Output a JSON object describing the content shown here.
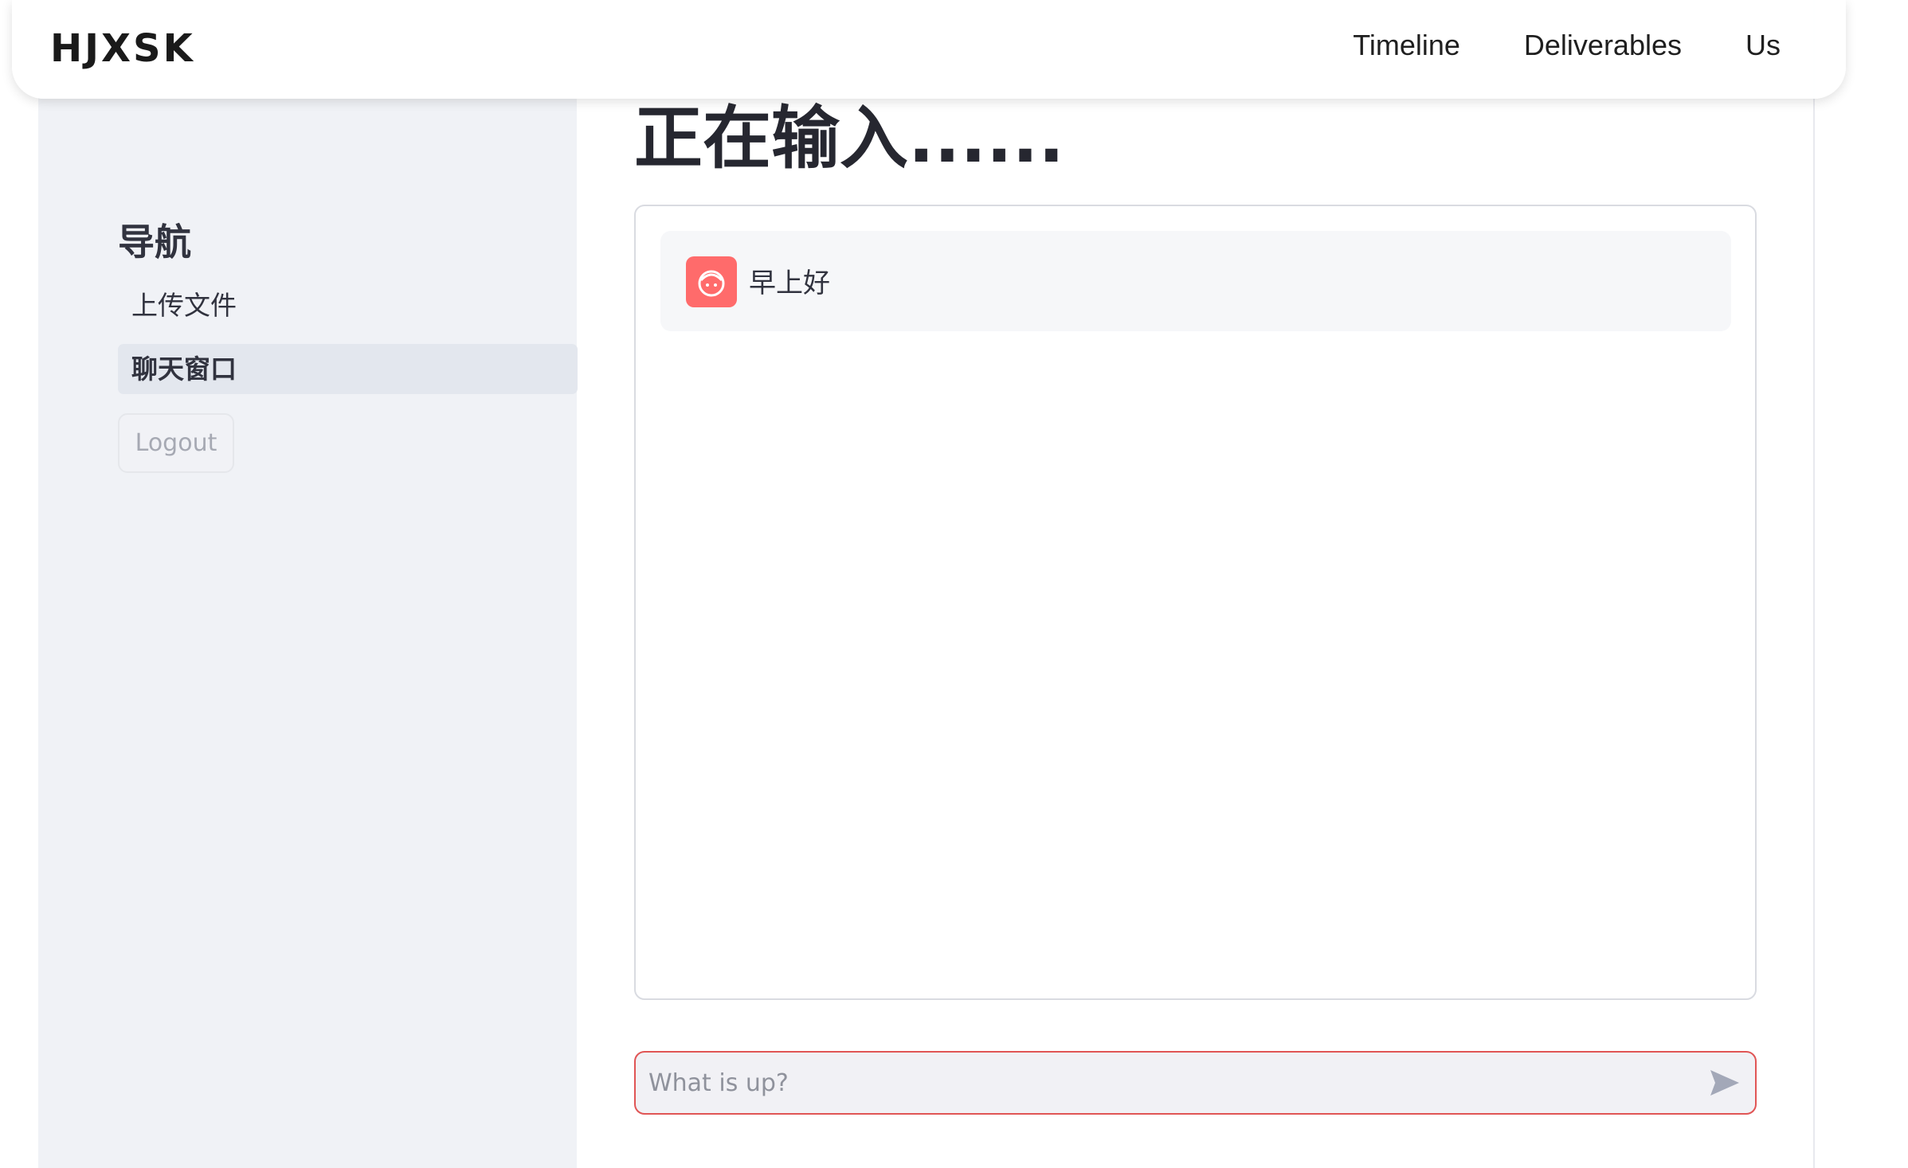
{
  "header": {
    "logo": "HJXSK",
    "nav": [
      "Timeline",
      "Deliverables",
      "Us"
    ]
  },
  "sidebar": {
    "title": "导航",
    "items": [
      {
        "label": "上传文件",
        "active": false
      },
      {
        "label": "聊天窗口",
        "active": true
      }
    ],
    "logout_label": "Logout"
  },
  "main": {
    "title": "正在输入......",
    "messages": [
      {
        "avatar_icon": "user-face-icon",
        "text": "早上好"
      }
    ],
    "input": {
      "placeholder": "What is up?",
      "value": "",
      "send_icon": "send-arrow-icon"
    }
  },
  "colors": {
    "sidebar_bg": "#f0f2f6",
    "active_item_bg": "#e3e7ee",
    "avatar_bg": "#ff6b6b",
    "input_border": "#e05555",
    "title_text": "#262730"
  }
}
